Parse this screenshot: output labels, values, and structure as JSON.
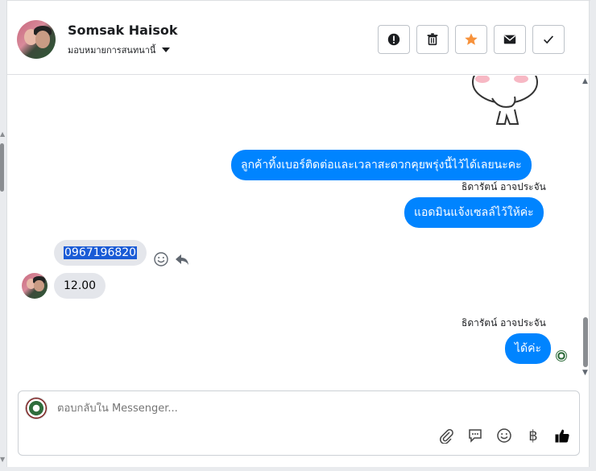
{
  "header": {
    "contact_name": "Somsak Haisok",
    "assign_label": "มอบหมายการสนทนานี้",
    "actions": [
      {
        "name": "spam-button",
        "icon": "exclamation-icon"
      },
      {
        "name": "delete-button",
        "icon": "trash-icon"
      },
      {
        "name": "star-button",
        "icon": "star-icon",
        "color": "#f7923b"
      },
      {
        "name": "mark-unread-button",
        "icon": "envelope-icon"
      },
      {
        "name": "mark-done-button",
        "icon": "check-icon"
      }
    ]
  },
  "messages": {
    "out1": "ลูกค้าทิ้งเบอร์ติดต่อและเวลาสะดวกคุยพรุ่งนี้ไว้ได้เลยนะคะ",
    "sender1": "ธิดารัตน์ อาจประจัน",
    "out2": "แอดมินแจ้งเซลล์ไว้ให้ค่ะ",
    "in1": "0967196820",
    "in2": "12.00",
    "sender2": "ธิดารัตน์ อาจประจัน",
    "out3": "ได้ค่ะ"
  },
  "composer": {
    "placeholder": "ตอบกลับใน Messenger..."
  },
  "tools": {
    "currency_symbol": "฿"
  },
  "colors": {
    "outgoing_bubble": "#0084ff",
    "incoming_bubble": "#e4e6eb",
    "selection": "#1a5bd6",
    "like": "#050505"
  }
}
